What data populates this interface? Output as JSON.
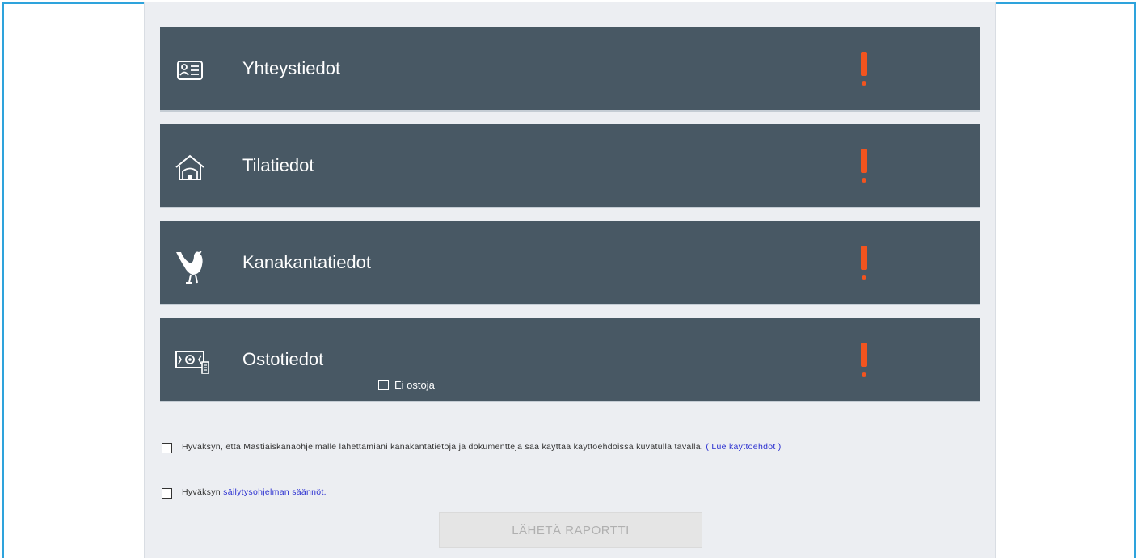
{
  "sections": [
    {
      "title": "Yhteystiedot",
      "icon": "contact-card-icon",
      "alert": "!"
    },
    {
      "title": "Tilatiedot",
      "icon": "house-icon",
      "alert": "!"
    },
    {
      "title": "Kanakantatiedot",
      "icon": "chicken-icon",
      "alert": "!"
    },
    {
      "title": "Ostotiedot",
      "icon": "money-receipt-icon",
      "alert": "!",
      "checkbox_label": "Ei ostoja"
    }
  ],
  "agreements": {
    "terms_text": "Hyväksyn, että Mastiaiskanaohjelmalle lähettämiäni kanakantatietoja ja dokumentteja saa käyttää käyttöehdoissa kuvatulla tavalla.",
    "terms_link": "( Lue käyttöehdot )",
    "rules_text": "Hyväksyn",
    "rules_link": "säilytysohjelman säännöt."
  },
  "submit_label": "LÄHETÄ RAPORTTI",
  "colors": {
    "frame": "#2ea3dc",
    "section_bg": "#485864",
    "alert": "#f2541f",
    "link": "#2a2fd0"
  }
}
